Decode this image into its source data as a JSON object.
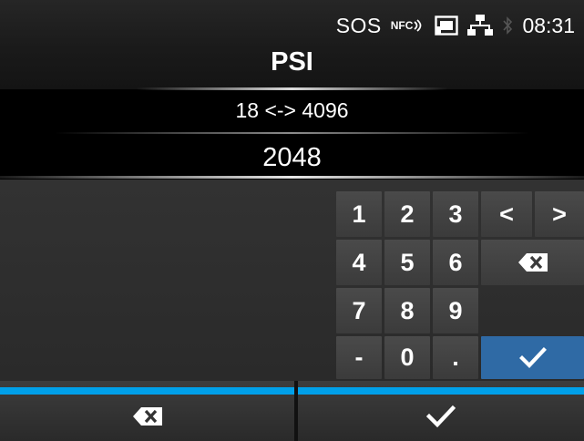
{
  "status": {
    "sos": "SOS",
    "nfc": "NFC",
    "time": "08:31",
    "icons": [
      "nfc-icon",
      "sd-card-icon",
      "network-icon",
      "bluetooth-icon"
    ]
  },
  "title": "PSI",
  "range": "18 <-> 4096",
  "value": "2048",
  "keypad": {
    "keys": [
      "1",
      "2",
      "3",
      "4",
      "5",
      "6",
      "7",
      "8",
      "9",
      "-",
      "0",
      "."
    ],
    "left_label": "<",
    "right_label": ">",
    "backspace_icon": "backspace-icon",
    "enter_icon": "checkmark-icon"
  },
  "bottom_bar": {
    "left_icon": "backspace-icon",
    "right_icon": "checkmark-icon"
  },
  "colors": {
    "accent": "#00a0e9",
    "enter_key": "#2f6aa5",
    "background": "#000000"
  }
}
